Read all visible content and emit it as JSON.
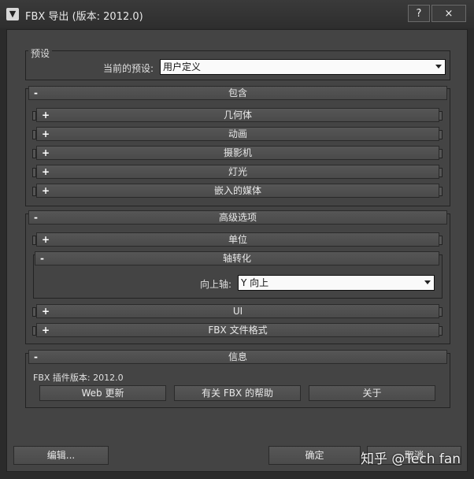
{
  "window": {
    "title": "FBX 导出 (版本: 2012.0)",
    "help": "?",
    "close": "×"
  },
  "preset": {
    "group": "预设",
    "label": "当前的预设:",
    "value": "用户定义"
  },
  "include": {
    "header": "包含",
    "items": [
      "几何体",
      "动画",
      "摄影机",
      "灯光",
      "嵌入的媒体"
    ]
  },
  "advanced": {
    "header": "高级选项",
    "units": "单位",
    "axis": {
      "header": "轴转化",
      "up_label": "向上轴:",
      "up_value": "Y 向上"
    },
    "ui": "UI",
    "file_format": "FBX 文件格式"
  },
  "info": {
    "header": "信息",
    "version": "FBX 插件版本: 2012.0",
    "web_update": "Web 更新",
    "help": "有关 FBX 的帮助",
    "about": "关于"
  },
  "footer": {
    "edit": "编辑...",
    "ok": "确定",
    "cancel": "取消"
  },
  "signs": {
    "expand": "+",
    "collapse": "-"
  },
  "watermark": "知乎 @Tech fan"
}
